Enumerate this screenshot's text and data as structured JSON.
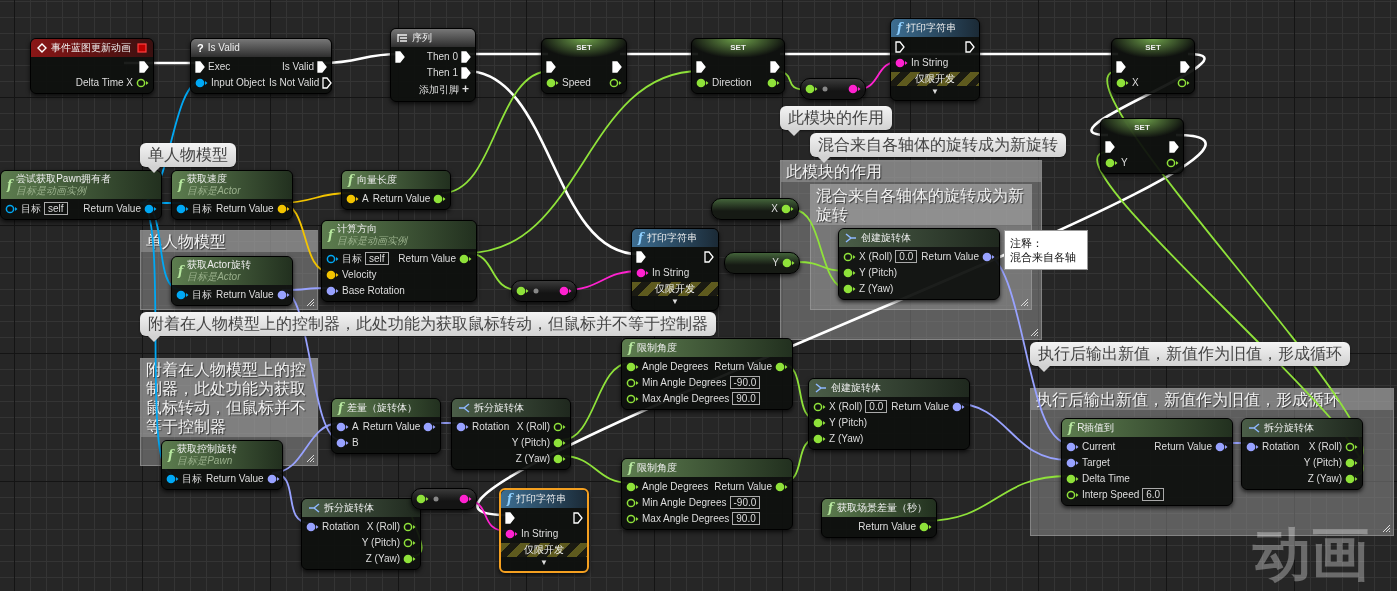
{
  "comments": [
    {
      "title": "单人物模型",
      "bubble": "单人物模型"
    },
    {
      "title": "附着在人物模型上的控制器，此处功能为获取鼠标转动，但鼠标并不等于控制器",
      "bubble": "附着在人物模型上的控制器，此处功能为获取鼠标转动，但鼠标并不等于控制器"
    },
    {
      "title": "此模块的作用",
      "bubble": "此模块的作用"
    },
    {
      "title": "混合来自各轴体的旋转成为新旋转",
      "bubble": "混合来自各轴体的旋转成为新旋转"
    },
    {
      "title": "执行后输出新值，新值作为旧值，形成循环",
      "bubble": "执行后输出新值，新值作为旧值，形成循环"
    }
  ],
  "note": [
    "注释：",
    "混合来自各轴"
  ],
  "nodes": [
    {
      "kind": "event",
      "title": "事件蓝图更新动画",
      "selected": false,
      "outputs": [
        {
          "kind": "exec",
          "connected": true
        },
        {
          "label": "Delta Time X",
          "kind": "data",
          "color": "#8fe23a",
          "connected": false
        }
      ]
    },
    {
      "kind": "macro",
      "glyph": "?",
      "title": "Is Valid",
      "selected": false,
      "inputs": [
        {
          "label": "Exec",
          "kind": "exec",
          "connected": true
        },
        {
          "label": "Input Object",
          "kind": "data",
          "color": "#00a8f4",
          "connected": true
        }
      ],
      "outputs": [
        {
          "label": "Is Valid",
          "kind": "exec",
          "connected": true
        },
        {
          "label": "Is Not Valid",
          "kind": "exec",
          "connected": false
        }
      ]
    },
    {
      "kind": "sequence",
      "title": "序列",
      "selected": false,
      "inputs": [
        {
          "kind": "exec",
          "connected": true
        }
      ],
      "outputs": [
        {
          "label": "Then 0",
          "kind": "exec",
          "connected": true
        },
        {
          "label": "Then 1",
          "kind": "exec",
          "connected": true
        }
      ],
      "add_pin": "添加引脚",
      "add_pin_glyph": "+"
    },
    {
      "kind": "set",
      "title": "SET",
      "selected": false,
      "inputs": [
        {
          "kind": "exec",
          "connected": true
        },
        {
          "label": "Speed",
          "kind": "data",
          "color": "#8fe23a",
          "connected": true
        }
      ],
      "outputs": [
        {
          "kind": "exec",
          "connected": true
        },
        {
          "kind": "data",
          "color": "#8fe23a",
          "connected": false
        }
      ]
    },
    {
      "kind": "set",
      "title": "SET",
      "selected": false,
      "inputs": [
        {
          "kind": "exec",
          "connected": true
        },
        {
          "label": "Direction",
          "kind": "data",
          "color": "#8fe23a",
          "connected": true
        }
      ],
      "outputs": [
        {
          "kind": "exec",
          "connected": true
        },
        {
          "kind": "data",
          "color": "#8fe23a",
          "connected": true
        }
      ]
    },
    {
      "kind": "convert",
      "selected": false,
      "inputs": [
        {
          "kind": "data",
          "color": "#8fe23a",
          "connected": true
        }
      ],
      "outputs": [
        {
          "kind": "data",
          "color": "#ff22d0",
          "connected": true
        }
      ]
    },
    {
      "kind": "print",
      "glyph": "f",
      "title": "打印字符串",
      "selected": false,
      "inputs": [
        {
          "kind": "exec",
          "connected": false
        },
        {
          "label": "In String",
          "kind": "data",
          "color": "#ff22d0",
          "connected": true
        }
      ],
      "outputs": [
        {
          "kind": "exec",
          "connected": false
        }
      ],
      "dev_only": "仅限开发",
      "expand": "▼"
    },
    {
      "kind": "set",
      "title": "SET",
      "selected": false,
      "inputs": [
        {
          "kind": "exec",
          "connected": true
        },
        {
          "label": "X",
          "kind": "data",
          "color": "#8fe23a",
          "connected": true
        }
      ],
      "outputs": [
        {
          "kind": "exec",
          "connected": true
        },
        {
          "kind": "data",
          "color": "#8fe23a",
          "connected": false
        }
      ]
    },
    {
      "kind": "set",
      "title": "SET",
      "selected": false,
      "inputs": [
        {
          "kind": "exec",
          "connected": true
        },
        {
          "label": "Y",
          "kind": "data",
          "color": "#8fe23a",
          "connected": true
        }
      ],
      "outputs": [
        {
          "kind": "exec",
          "connected": true
        },
        {
          "kind": "data",
          "color": "#8fe23a",
          "connected": false
        }
      ]
    },
    {
      "kind": "function",
      "glyph": "f",
      "title": "尝试获取Pawn拥有者",
      "subtitle": "目标是动画实例",
      "selected": false,
      "inputs": [
        {
          "label": "目标",
          "kind": "data",
          "color": "#00a8f4",
          "connected": false,
          "default": "self"
        }
      ],
      "outputs": [
        {
          "label": "Return Value",
          "kind": "data",
          "color": "#00a8f4",
          "connected": true
        }
      ]
    },
    {
      "kind": "function",
      "glyph": "f",
      "title": "获取速度",
      "subtitle": "目标是Actor",
      "selected": false,
      "inputs": [
        {
          "label": "目标",
          "kind": "data",
          "color": "#00a8f4",
          "connected": true
        }
      ],
      "outputs": [
        {
          "label": "Return Value",
          "kind": "data",
          "color": "#f3c400",
          "connected": true
        }
      ]
    },
    {
      "kind": "function",
      "glyph": "f",
      "title": "获取Actor旋转",
      "subtitle": "目标是Actor",
      "selected": false,
      "inputs": [
        {
          "label": "目标",
          "kind": "data",
          "color": "#00a8f4",
          "connected": true
        }
      ],
      "outputs": [
        {
          "label": "Return Value",
          "kind": "data",
          "color": "#98a2ff",
          "connected": true
        }
      ]
    },
    {
      "kind": "function",
      "glyph": "f",
      "title": "向量长度",
      "selected": false,
      "inputs": [
        {
          "label": "A",
          "kind": "data",
          "color": "#f3c400",
          "connected": true
        }
      ],
      "outputs": [
        {
          "label": "Return Value",
          "kind": "data",
          "color": "#8fe23a",
          "connected": true
        }
      ]
    },
    {
      "kind": "function",
      "glyph": "f",
      "title": "计算方向",
      "subtitle": "目标是动画实例",
      "selected": false,
      "inputs": [
        {
          "label": "目标",
          "kind": "data",
          "color": "#00a8f4",
          "connected": false,
          "default": "self"
        },
        {
          "label": "Velocity",
          "kind": "data",
          "color": "#f3c400",
          "connected": true
        },
        {
          "label": "Base Rotation",
          "kind": "data",
          "color": "#98a2ff",
          "connected": true
        }
      ],
      "outputs": [
        {
          "label": "Return Value",
          "kind": "data",
          "color": "#8fe23a",
          "connected": true
        }
      ]
    },
    {
      "kind": "variable",
      "selected": false,
      "outputs": [
        {
          "label": "X",
          "kind": "data",
          "color": "#8fe23a",
          "connected": true
        }
      ]
    },
    {
      "kind": "convert",
      "selected": false,
      "inputs": [
        {
          "kind": "data",
          "color": "#8fe23a",
          "connected": true
        }
      ],
      "outputs": [
        {
          "kind": "data",
          "color": "#ff22d0",
          "connected": true
        }
      ]
    },
    {
      "kind": "print",
      "glyph": "f",
      "title": "打印字符串",
      "selected": false,
      "inputs": [
        {
          "kind": "exec",
          "connected": true
        },
        {
          "label": "In String",
          "kind": "data",
          "color": "#ff22d0",
          "connected": true
        }
      ],
      "outputs": [
        {
          "kind": "exec",
          "connected": false
        }
      ],
      "dev_only": "仅限开发",
      "expand": "▼"
    },
    {
      "kind": "variable",
      "selected": false,
      "outputs": [
        {
          "label": "Y",
          "kind": "data",
          "color": "#8fe23a",
          "connected": true
        }
      ]
    },
    {
      "kind": "make",
      "title": "创建旋转体",
      "selected": false,
      "inputs": [
        {
          "label": "X (Roll)",
          "kind": "data",
          "color": "#8fe23a",
          "connected": false,
          "default": "0.0"
        },
        {
          "label": "Y (Pitch)",
          "kind": "data",
          "color": "#8fe23a",
          "connected": true
        },
        {
          "label": "Z (Yaw)",
          "kind": "data",
          "color": "#8fe23a",
          "connected": true
        }
      ],
      "outputs": [
        {
          "label": "Return Value",
          "kind": "data",
          "color": "#98a2ff",
          "connected": true
        }
      ]
    },
    {
      "kind": "function",
      "glyph": "f",
      "title": "获取控制旋转",
      "subtitle": "目标是Pawn",
      "selected": false,
      "inputs": [
        {
          "label": "目标",
          "kind": "data",
          "color": "#00a8f4",
          "connected": true
        }
      ],
      "outputs": [
        {
          "label": "Return Value",
          "kind": "data",
          "color": "#98a2ff",
          "connected": true
        }
      ]
    },
    {
      "kind": "function",
      "glyph": "f",
      "title": "差量（旋转体）",
      "selected": false,
      "inputs": [
        {
          "label": "A",
          "kind": "data",
          "color": "#98a2ff",
          "connected": true
        },
        {
          "label": "B",
          "kind": "data",
          "color": "#98a2ff",
          "connected": true
        }
      ],
      "outputs": [
        {
          "label": "Return Value",
          "kind": "data",
          "color": "#98a2ff",
          "connected": true
        }
      ]
    },
    {
      "kind": "break",
      "title": "拆分旋转体",
      "selected": false,
      "inputs": [
        {
          "label": "Rotation",
          "kind": "data",
          "color": "#98a2ff",
          "connected": true
        }
      ],
      "outputs": [
        {
          "label": "X (Roll)",
          "kind": "data",
          "color": "#8fe23a",
          "connected": false
        },
        {
          "label": "Y (Pitch)",
          "kind": "data",
          "color": "#8fe23a",
          "connected": true
        },
        {
          "label": "Z (Yaw)",
          "kind": "data",
          "color": "#8fe23a",
          "connected": true
        }
      ]
    },
    {
      "kind": "break",
      "title": "拆分旋转体",
      "selected": false,
      "inputs": [
        {
          "label": "Rotation",
          "kind": "data",
          "color": "#98a2ff",
          "connected": true
        }
      ],
      "outputs": [
        {
          "label": "X (Roll)",
          "kind": "data",
          "color": "#8fe23a",
          "connected": false
        },
        {
          "label": "Y (Pitch)",
          "kind": "data",
          "color": "#8fe23a",
          "connected": false
        },
        {
          "label": "Z (Yaw)",
          "kind": "data",
          "color": "#8fe23a",
          "connected": true
        }
      ]
    },
    {
      "kind": "convert",
      "selected": false,
      "inputs": [
        {
          "kind": "data",
          "color": "#8fe23a",
          "connected": true
        }
      ],
      "outputs": [
        {
          "kind": "data",
          "color": "#ff22d0",
          "connected": true
        }
      ]
    },
    {
      "kind": "print",
      "glyph": "f",
      "title": "打印字符串",
      "selected": true,
      "inputs": [
        {
          "kind": "exec",
          "connected": true
        },
        {
          "label": "In String",
          "kind": "data",
          "color": "#ff22d0",
          "connected": true
        }
      ],
      "outputs": [
        {
          "kind": "exec",
          "connected": false
        }
      ],
      "dev_only": "仅限开发",
      "expand": "▼"
    },
    {
      "kind": "function",
      "glyph": "f",
      "title": "限制角度",
      "selected": false,
      "inputs": [
        {
          "label": "Angle Degrees",
          "kind": "data",
          "color": "#8fe23a",
          "connected": true
        },
        {
          "label": "Min Angle Degrees",
          "kind": "data",
          "color": "#8fe23a",
          "connected": false,
          "default": "-90.0"
        },
        {
          "label": "Max Angle Degrees",
          "kind": "data",
          "color": "#8fe23a",
          "connected": false,
          "default": "90.0"
        }
      ],
      "outputs": [
        {
          "label": "Return Value",
          "kind": "data",
          "color": "#8fe23a",
          "connected": true
        }
      ]
    },
    {
      "kind": "function",
      "glyph": "f",
      "title": "限制角度",
      "selected": false,
      "inputs": [
        {
          "label": "Angle Degrees",
          "kind": "data",
          "color": "#8fe23a",
          "connected": true
        },
        {
          "label": "Min Angle Degrees",
          "kind": "data",
          "color": "#8fe23a",
          "connected": false,
          "default": "-90.0"
        },
        {
          "label": "Max Angle Degrees",
          "kind": "data",
          "color": "#8fe23a",
          "connected": false,
          "default": "90.0"
        }
      ],
      "outputs": [
        {
          "label": "Return Value",
          "kind": "data",
          "color": "#8fe23a",
          "connected": true
        }
      ]
    },
    {
      "kind": "make",
      "title": "创建旋转体",
      "selected": false,
      "inputs": [
        {
          "label": "X (Roll)",
          "kind": "data",
          "color": "#8fe23a",
          "connected": false,
          "default": "0.0"
        },
        {
          "label": "Y (Pitch)",
          "kind": "data",
          "color": "#8fe23a",
          "connected": true
        },
        {
          "label": "Z (Yaw)",
          "kind": "data",
          "color": "#8fe23a",
          "connected": true
        }
      ],
      "outputs": [
        {
          "label": "Return Value",
          "kind": "data",
          "color": "#98a2ff",
          "connected": true
        }
      ]
    },
    {
      "kind": "function",
      "glyph": "f",
      "title": "获取场景差量（秒）",
      "selected": false,
      "outputs": [
        {
          "label": "Return Value",
          "kind": "data",
          "color": "#8fe23a",
          "connected": true
        }
      ]
    },
    {
      "kind": "function",
      "glyph": "f",
      "title": "R插值到",
      "selected": false,
      "inputs": [
        {
          "label": "Current",
          "kind": "data",
          "color": "#98a2ff",
          "connected": true
        },
        {
          "label": "Target",
          "kind": "data",
          "color": "#98a2ff",
          "connected": true
        },
        {
          "label": "Delta Time",
          "kind": "data",
          "color": "#8fe23a",
          "connected": true
        },
        {
          "label": "Interp Speed",
          "kind": "data",
          "color": "#8fe23a",
          "connected": false,
          "default": "6.0"
        }
      ],
      "outputs": [
        {
          "label": "Return Value",
          "kind": "data",
          "color": "#98a2ff",
          "connected": true
        }
      ]
    },
    {
      "kind": "break",
      "title": "拆分旋转体",
      "selected": false,
      "inputs": [
        {
          "label": "Rotation",
          "kind": "data",
          "color": "#98a2ff",
          "connected": true
        }
      ],
      "outputs": [
        {
          "label": "X (Roll)",
          "kind": "data",
          "color": "#8fe23a",
          "connected": false
        },
        {
          "label": "Y (Pitch)",
          "kind": "data",
          "color": "#8fe23a",
          "connected": true
        },
        {
          "label": "Z (Yaw)",
          "kind": "data",
          "color": "#8fe23a",
          "connected": true
        }
      ]
    }
  ],
  "graph_label": "动画"
}
